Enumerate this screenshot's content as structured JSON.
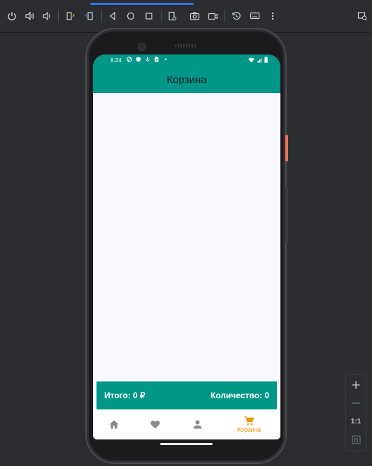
{
  "emulator": {
    "toolbar_icons": [
      "power-icon",
      "volume-up-icon",
      "volume-down-icon",
      "rotate-left-icon",
      "rotate-right-icon",
      "back-icon",
      "home-icon",
      "overview-icon",
      "fold-icon",
      "screenshot-icon",
      "screenrecord-icon",
      "snapshot-icon",
      "keyboard-icon",
      "more-icon"
    ],
    "zoom_ratio_label": "1:1"
  },
  "status_bar": {
    "time": "8:24"
  },
  "app_bar": {
    "title": "Корзина"
  },
  "cart": {
    "total_label": "Итого: 0 ₽",
    "count_label": "Количество: 0"
  },
  "bottom_nav": {
    "items": [
      {
        "icon": "home-icon",
        "label": ""
      },
      {
        "icon": "heart-icon",
        "label": ""
      },
      {
        "icon": "person-icon",
        "label": ""
      },
      {
        "icon": "cart-icon",
        "label": "Корзина"
      }
    ],
    "active_index": 3
  },
  "colors": {
    "primary": "#009688",
    "active_nav": "#e89a00",
    "inactive_nav": "#8a8a8a",
    "background": "#f8f9fe"
  }
}
